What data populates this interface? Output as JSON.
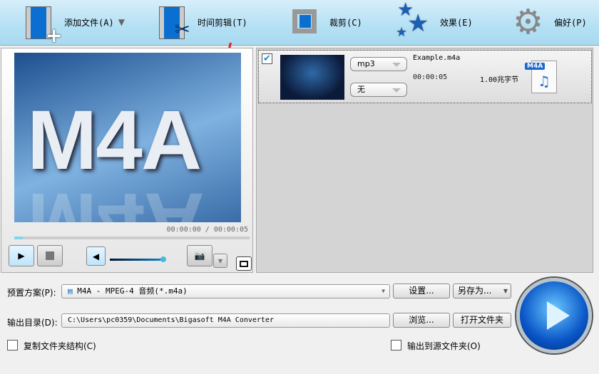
{
  "toolbar": {
    "add_file": "添加文件(A)",
    "trim": "时间剪辑(T)",
    "crop": "裁剪(C)",
    "effect": "效果(E)",
    "preferences": "偏好(P)"
  },
  "preview": {
    "title_art": "M4A",
    "time": "00:00:00 / 00:00:05",
    "progress": 0.03,
    "volume": 1.0
  },
  "file_item": {
    "checked": true,
    "format": "mp3",
    "subtitle": "无",
    "name": "Example.m4a",
    "duration": "00:00:05",
    "size": "1.00兆字节",
    "badge": "M4A"
  },
  "settings": {
    "preset_label": "预置方案(P):",
    "preset_value": "M4A - MPEG-4 音频(*.m4a)",
    "settings_button": "设置...",
    "save_as_button": "另存为...",
    "output_label": "输出目录(D):",
    "output_value": "C:\\Users\\pc0359\\Documents\\Bigasoft M4A Converter",
    "browse_button": "浏览...",
    "open_folder_button": "打开文件夹",
    "copy_structure_label": "复制文件夹结构(C)",
    "output_to_source_label": "输出到源文件夹(O)"
  }
}
